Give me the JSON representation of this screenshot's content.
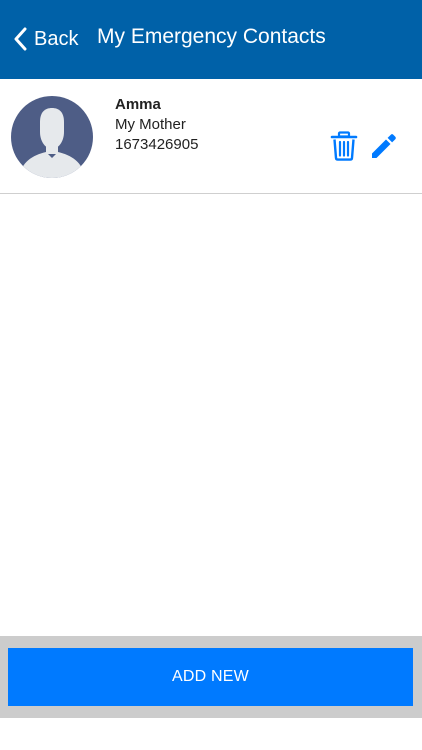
{
  "header": {
    "back_label": "Back",
    "title": "My Emergency Contacts"
  },
  "contacts": [
    {
      "name": "Amma",
      "relation": "My Mother",
      "phone": "1673426905",
      "avatar_icon": "default-person-avatar-icon",
      "actions": [
        "trash-icon",
        "pencil-icon"
      ]
    }
  ],
  "footer": {
    "add_new_label": "ADD NEW"
  },
  "colors": {
    "header_bg": "#0061a8",
    "accent": "#007aff",
    "avatar_bg": "#4e5d86",
    "avatar_figure": "#e6e9ec",
    "bottom_bar_bg": "#cccccc"
  }
}
